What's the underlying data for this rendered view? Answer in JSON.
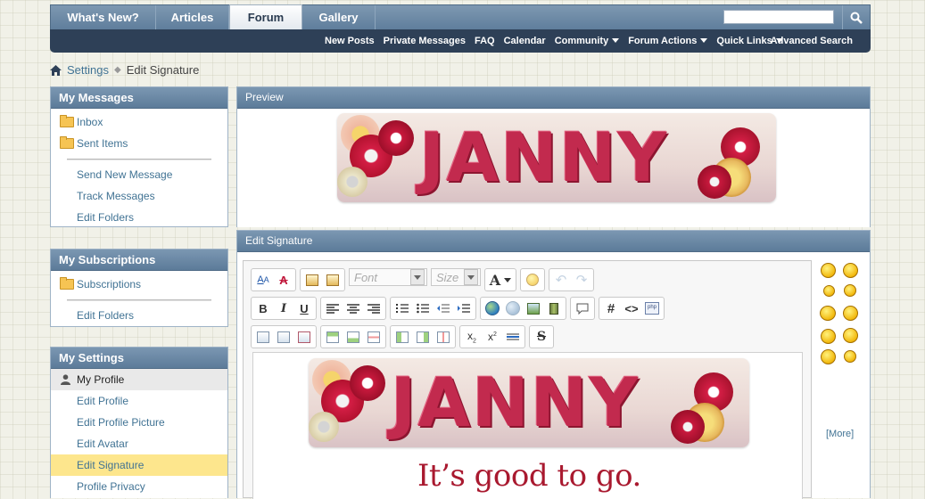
{
  "navbar": {
    "tabs": [
      {
        "label": "What's New?",
        "active": false
      },
      {
        "label": "Articles",
        "active": false
      },
      {
        "label": "Forum",
        "active": true
      },
      {
        "label": "Gallery",
        "active": false
      }
    ],
    "search": {
      "placeholder": ""
    },
    "subnav": [
      "New Posts",
      "Private Messages",
      "FAQ",
      "Calendar"
    ],
    "subnav_dropdowns": [
      "Community",
      "Forum Actions",
      "Quick Links"
    ],
    "advanced_search": "Advanced Search"
  },
  "breadcrumb": {
    "link": "Settings",
    "current": "Edit Signature"
  },
  "my_messages": {
    "title": "My Messages",
    "folders": [
      "Inbox",
      "Sent Items"
    ],
    "links": [
      "Send New Message",
      "Track Messages",
      "Edit Folders"
    ]
  },
  "my_subscriptions": {
    "title": "My Subscriptions",
    "folders": [
      "Subscriptions"
    ],
    "links": [
      "Edit Folders"
    ]
  },
  "my_settings": {
    "title": "My Settings",
    "section": "My Profile",
    "links": [
      "Edit Profile",
      "Edit Profile Picture",
      "Edit Avatar",
      "Edit Signature",
      "Profile Privacy"
    ],
    "active": "Edit Signature"
  },
  "preview": {
    "title": "Preview",
    "banner_text": "JANNY"
  },
  "edit_signature": {
    "title": "Edit Signature",
    "font_placeholder": "Font",
    "size_placeholder": "Size",
    "banner_text": "JANNY",
    "body_text": "It’s good to go.",
    "more_link": "[More]"
  },
  "colors": {
    "nav_dark": "#2e4057",
    "nav_blue": "#6c89a5",
    "link": "#417394",
    "highlight": "#fde68d",
    "accent_red": "#c22a4e"
  }
}
